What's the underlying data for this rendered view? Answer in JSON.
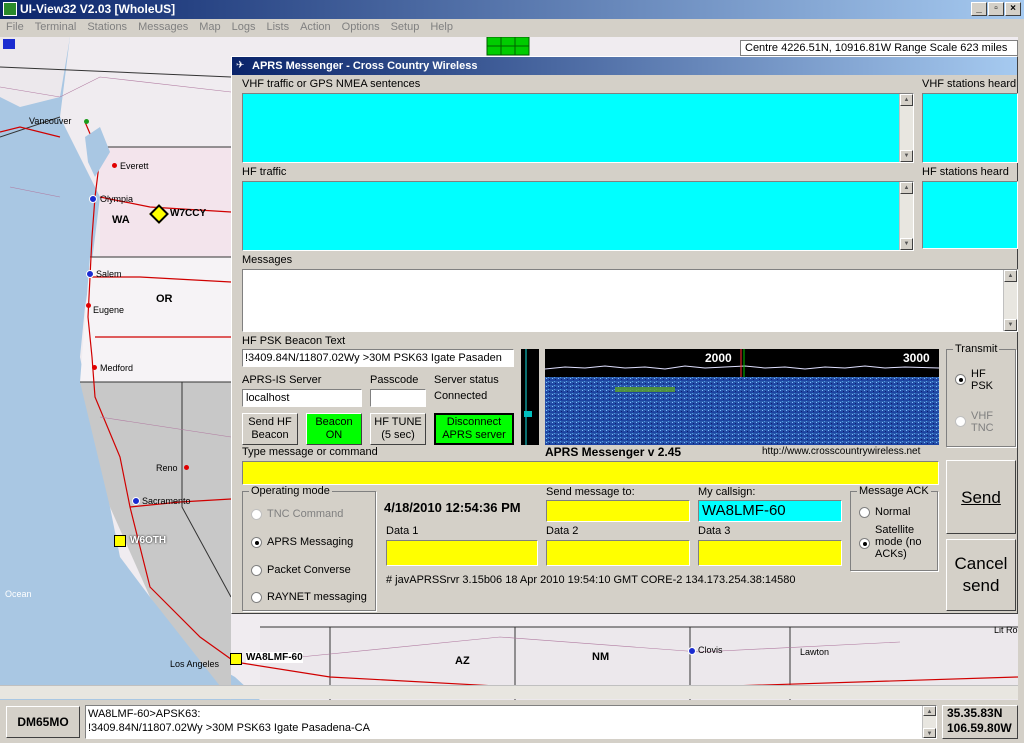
{
  "app": {
    "title": "UI-View32 V2.03 [WholeUS]"
  },
  "menu": [
    "File",
    "Terminal",
    "Stations",
    "Messages",
    "Map",
    "Logs",
    "Lists",
    "Action",
    "Options",
    "Setup",
    "Help"
  ],
  "map": {
    "info": "Centre 4226.51N, 10916.81W Range Scale 623 miles",
    "states": [
      "WA",
      "OR",
      "AZ",
      "NM"
    ],
    "cities": [
      "Vancouver",
      "Everett",
      "Olympia",
      "Salem",
      "Eugene",
      "Medford",
      "Reno",
      "Sacramento",
      "Los Angeles",
      "Clovis",
      "Lawton",
      "Lit Ro"
    ],
    "ocean_label": "Ocean",
    "stations": [
      "W7CCY",
      "W6OTH",
      "WA8LMF-60"
    ]
  },
  "dialog": {
    "title": "APRS Messenger - Cross Country Wireless",
    "vhf_traffic_label": "VHF traffic or GPS NMEA sentences",
    "vhf_heard_label": "VHF stations heard",
    "hf_traffic_label": "HF traffic",
    "hf_heard_label": "HF stations heard",
    "messages_label": "Messages",
    "beacon_text_label": "HF PSK Beacon Text",
    "beacon_text": "!3409.84N/11807.02Wy >30M PSK63 Igate Pasaden",
    "aprs_server_label": "APRS-IS Server",
    "aprs_server": "localhost",
    "passcode_label": "Passcode",
    "server_status_label": "Server status",
    "server_status": "Connected",
    "send_hf_beacon": "Send HF Beacon",
    "beacon_on": "Beacon ON",
    "hf_tune": "HF TUNE (5 sec)",
    "disconnect": "Disconnect APRS server",
    "waterfall_title": "APRS Messenger v 2.45",
    "waterfall_url": "http://www.crosscountrywireless.net",
    "waterfall_ticks": [
      "2000",
      "3000"
    ],
    "transmit_label": "Transmit",
    "transmit_hf": "HF PSK",
    "transmit_vhf": "VHF TNC",
    "type_message_label": "Type message or command",
    "operating_mode_label": "Operating mode",
    "modes": [
      {
        "label": "TNC Command",
        "selected": false,
        "enabled": false
      },
      {
        "label": "APRS Messaging",
        "selected": true,
        "enabled": true
      },
      {
        "label": "Packet Converse",
        "selected": false,
        "enabled": true
      },
      {
        "label": "RAYNET messaging",
        "selected": false,
        "enabled": true
      }
    ],
    "datetime": "4/18/2010 12:54:36 PM",
    "send_to_label": "Send message to:",
    "my_callsign_label": "My callsign:",
    "my_callsign": "WA8LMF-60",
    "data1_label": "Data 1",
    "data2_label": "Data 2",
    "data3_label": "Data 3",
    "server_line": "# javAPRSSrvr 3.15b06 18 Apr 2010 19:54:10 GMT CORE-2 134.173.254.38:14580",
    "message_ack_label": "Message ACK",
    "ack_normal": "Normal",
    "ack_satellite": "Satellite mode (no ACKs)",
    "send_button": "Send",
    "cancel_button": "Cancel send"
  },
  "status": {
    "grid": "DM65MO",
    "packet_line1": "WA8LMF-60>APSK63:",
    "packet_line2": "!3409.84N/11807.02Wy >30M PSK63  Igate  Pasadena-CA",
    "lat": "35.35.83N",
    "lon": "106.59.80W"
  },
  "colors": {
    "cyan": "#00ffff",
    "yellow": "#ffff00",
    "green": "#00ff00",
    "title_blue": "#0a246a"
  }
}
